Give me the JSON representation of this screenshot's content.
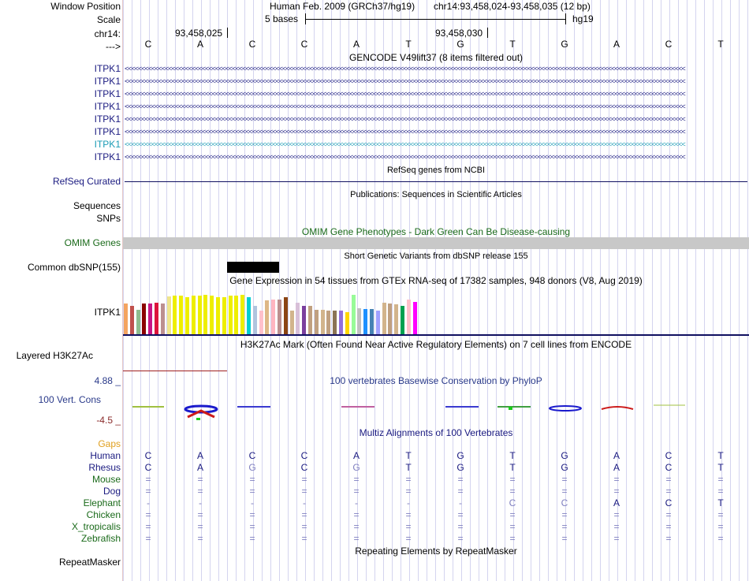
{
  "labels": {
    "window_position": "Window Position",
    "scale": "Scale",
    "chrom": "chr14:",
    "strand": "--->",
    "gencode_rows": [
      "ITPK1",
      "ITPK1",
      "ITPK1",
      "ITPK1",
      "ITPK1",
      "ITPK1",
      "ITPK1",
      "ITPK1"
    ],
    "refseq": "RefSeq Curated",
    "sequences": "Sequences",
    "snps": "SNPs",
    "omim": "OMIM Genes",
    "dbsnp": "Common dbSNP(155)",
    "gtex": "ITPK1",
    "layered": "Layered H3K27Ac",
    "phylop_max": "4.88 _",
    "phylop": "100 Vert. Cons",
    "phylop_min": "-4.5 _",
    "gaps": "Gaps",
    "species": [
      "Human",
      "Rhesus",
      "Mouse",
      "Dog",
      "Elephant",
      "Chicken",
      "X_tropicalis",
      "Zebrafish"
    ],
    "repeatmasker": "RepeatMasker"
  },
  "header": {
    "assembly": "Human Feb. 2009 (GRCh37/hg19)",
    "position": "chr14:93,458,024-93,458,035 (12 bp)",
    "scale_text": "5 bases",
    "db": "hg19",
    "coord1": "93,458,025",
    "coord2": "93,458,030"
  },
  "bases": [
    "C",
    "A",
    "C",
    "C",
    "A",
    "T",
    "G",
    "T",
    "G",
    "A",
    "C",
    "T"
  ],
  "tracks": {
    "gencode_title": "GENCODE V49lift37 (8 items filtered out)",
    "refseq_title": "RefSeq genes from NCBI",
    "pubs_title": "Publications: Sequences in Scientific Articles",
    "omim_title": "OMIM Gene Phenotypes - Dark Green Can Be Disease-causing",
    "dbsnp_title": "Short Genetic Variants from dbSNP release 155",
    "gtex_title": "Gene Expression in 54 tissues from GTEx RNA-seq of 17382 samples, 948 donors (V8, Aug 2019)",
    "h3k27_title": "H3K27Ac Mark (Often Found Near Active Regulatory Elements) on 7 cell lines from ENCODE",
    "phylop_title": "100 vertebrates Basewise Conservation by PhyloP",
    "multiz_title": "Multiz Alignments of 100 Vertebrates",
    "repeat_title": "Repeating Elements by RepeatMasker",
    "chevron_text": "<<<<<<<<<<<<<<<<<<<<<<<<<<<<<<<<<<<<<<<<<<<<<<<<<<<<<<<<<<<<<<<<<<<<<<<<<<<<<<<<<<<<<<<<<<<<<<<<<<<<<<<<<<<<<<<<<<<<<<<<<<<<<<<<<<<<<<<<<<<<<<<<<<<<<<<<<<<<<<<<<<<<<<<"
  },
  "alignment": {
    "Human": [
      "C",
      "A",
      "C",
      "C",
      "A",
      "T",
      "G",
      "T",
      "G",
      "A",
      "C",
      "T"
    ],
    "Rhesus": [
      "C",
      "A",
      "G",
      "C",
      "G",
      "T",
      "G",
      "T",
      "G",
      "A",
      "C",
      "T"
    ],
    "Mouse": [
      "=",
      "=",
      "=",
      "=",
      "=",
      "=",
      "=",
      "=",
      "=",
      "=",
      "=",
      "="
    ],
    "Dog": [
      "=",
      "=",
      "=",
      "=",
      "=",
      "=",
      "=",
      "=",
      "=",
      "=",
      "=",
      "="
    ],
    "Elephant": [
      "-",
      "-",
      "-",
      "-",
      "-",
      "-",
      "-",
      "C",
      "C",
      "A",
      "C",
      "T"
    ],
    "Chicken": [
      "=",
      "=",
      "=",
      "=",
      "=",
      "=",
      "=",
      "=",
      "=",
      "=",
      "=",
      "="
    ],
    "X_tropicalis": [
      "=",
      "=",
      "=",
      "=",
      "=",
      "=",
      "=",
      "=",
      "=",
      "=",
      "=",
      "="
    ],
    "Zebrafish": [
      "=",
      "=",
      "=",
      "=",
      "=",
      "=",
      "=",
      "=",
      "=",
      "=",
      "=",
      "="
    ]
  },
  "colors": {
    "navy": "#1a1a80",
    "cyan_transcript": "#1a9bb5",
    "omim_green": "#1a6a1a",
    "phylop_max": "#2a3a8a",
    "phylop_min": "#8a2a2a",
    "gaps": "#e0a020",
    "omim_bar": "#c8c8c8",
    "h3k27_line": "#a02020"
  },
  "gtex_colors": [
    "#f4a460",
    "#c0504d",
    "#8fbc8f",
    "#8b0000",
    "#c71585",
    "#dc143c",
    "#bc8f8f",
    "#f0e68c",
    "#eeee00",
    "#eeee00",
    "#eeee00",
    "#eeee00",
    "#eeee00",
    "#eeee00",
    "#eeee00",
    "#eeee00",
    "#eeee00",
    "#eeee00",
    "#eeee00",
    "#eeee00",
    "#00ced1",
    "#b0c4de",
    "#ffc0cb",
    "#deb887",
    "#ffb6c1",
    "#bc8f8f",
    "#8b4513",
    "#d2b48c",
    "#d8bfd8",
    "#7b3f9e",
    "#c0a080",
    "#c0a080",
    "#d2b48c",
    "#c0a080",
    "#8b7355",
    "#9370db",
    "#ffd700",
    "#98fb98",
    "#c0c0c0",
    "#1e90ff",
    "#4682b4",
    "#a0a0ff",
    "#d2b48c",
    "#c0a080",
    "#d2b48c",
    "#00a050",
    "#ffc0cb",
    "#ff00ff"
  ],
  "gtex_values": [
    0.78,
    0.72,
    0.62,
    0.78,
    0.78,
    0.8,
    0.78,
    0.95,
    0.97,
    0.97,
    0.93,
    0.97,
    0.97,
    1.0,
    0.98,
    0.93,
    0.93,
    0.97,
    0.98,
    1.0,
    0.93,
    0.72,
    0.6,
    0.85,
    0.88,
    0.88,
    0.93,
    0.6,
    0.8,
    0.72,
    0.72,
    0.62,
    0.62,
    0.6,
    0.6,
    0.6,
    0.57,
    1.0,
    0.65,
    0.63,
    0.63,
    0.6,
    0.8,
    0.77,
    0.75,
    0.72,
    0.88,
    0.82
  ]
}
